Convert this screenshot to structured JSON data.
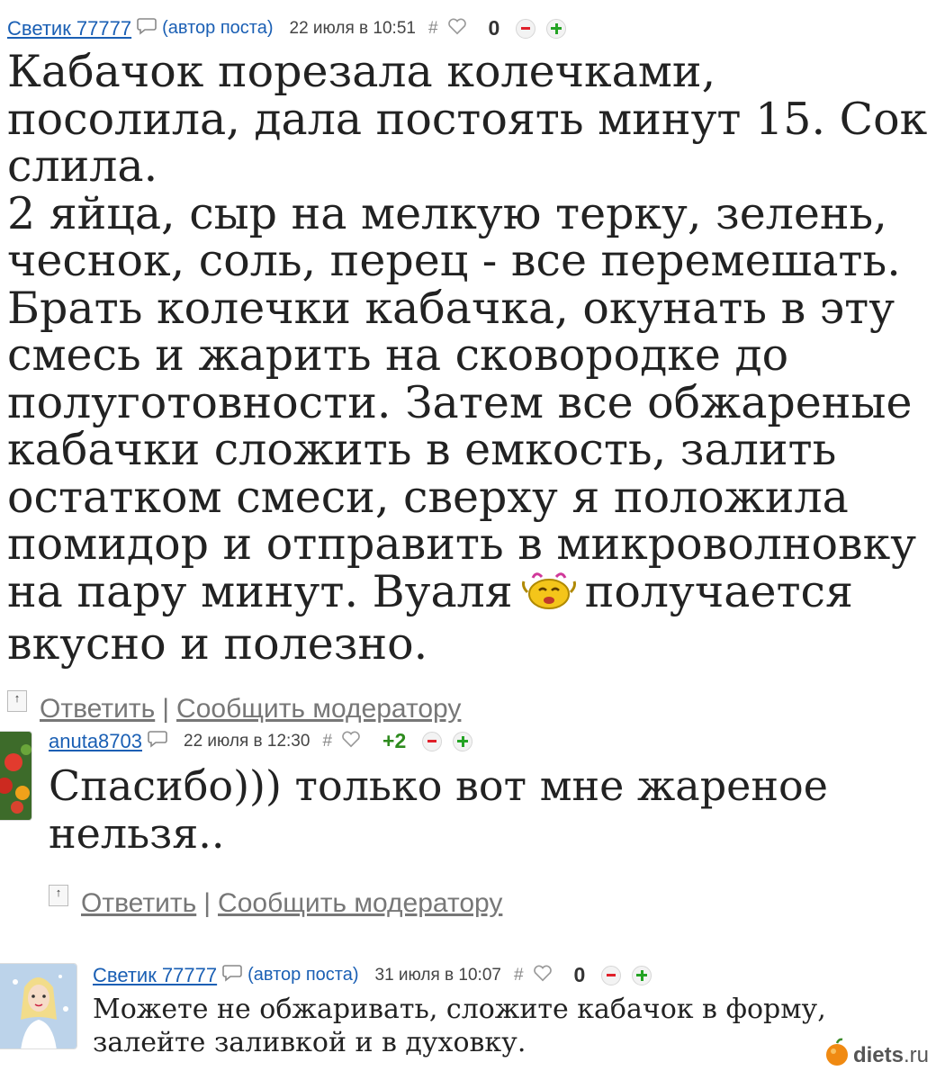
{
  "comments": [
    {
      "author": "Светик 77777",
      "author_tag": "(автор поста)",
      "date": "22 июля в 10:51",
      "hash": "#",
      "score": "0",
      "text_parts": [
        "Кабачок порезала колечками, посолила, дала постоять минут 15. Сок слила.\n2 яйца, сыр на мелкую терку, зелень, чеснок, соль, перец - все перемешать. Брать колечки кабачка, окунать в эту смесь и жарить на сковородке до полуготовности. Затем все обжареные кабачки сложить в емкость, залить остатком смеси, сверху я положила помидор и отправить в микроволновку на пару минут. Вуаля",
        "получается вкусно и полезно."
      ],
      "reply": "Ответить",
      "report": "Сообщить модератору",
      "up": "↑"
    },
    {
      "author": "anuta8703",
      "date": "22 июля в 12:30",
      "hash": "#",
      "score": "+2",
      "text": "Спасибо))) только вот мне жареное нельзя..",
      "reply": "Ответить",
      "report": "Сообщить модератору",
      "up": "↑"
    },
    {
      "author": "Светик 77777",
      "author_tag": "(автор поста)",
      "date": "31 июля в 10:07",
      "hash": "#",
      "score": "0",
      "text": "Можете не обжаривать, сложите кабачок в форму, залейте заливкой и в духовку."
    }
  ],
  "separator": "|",
  "watermark": {
    "name": "diets",
    "tld": ".ru"
  },
  "icons": [
    "message-icon",
    "heart-icon",
    "minus-icon",
    "plus-icon",
    "smiley-icon",
    "apple-logo-icon"
  ],
  "colors": {
    "link": "#1a5fb4",
    "positive": "#2e8b1e",
    "minus": "#e0202a",
    "plus": "#24a324"
  }
}
